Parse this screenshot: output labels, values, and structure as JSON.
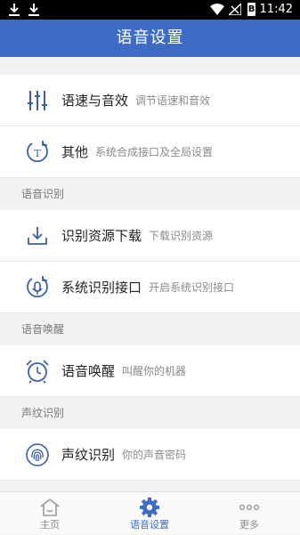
{
  "status_bar": {
    "time": "11:42",
    "battery_label": "B"
  },
  "header": {
    "title": "语音设置"
  },
  "sections": {
    "recognition": "语音识别",
    "wakeup": "语音唤醒",
    "voiceprint": "声纹识别"
  },
  "cells": {
    "speed_effect": {
      "title": "语速与音效",
      "subtitle": "调节语速和音效",
      "icon": "sliders-icon"
    },
    "other": {
      "title": "其他",
      "subtitle": "系统合成接口及全局设置",
      "icon": "text-refresh-icon"
    },
    "download": {
      "title": "识别资源下载",
      "subtitle": "下载识别资源",
      "icon": "download-icon"
    },
    "system_interface": {
      "title": "系统识别接口",
      "subtitle": "开启系统识别接口",
      "icon": "mic-refresh-icon"
    },
    "wakeup": {
      "title": "语音唤醒",
      "subtitle": "叫醒你的机器",
      "icon": "alarm-clock-icon"
    },
    "voiceprint": {
      "title": "声纹识别",
      "subtitle": "你的声音密码",
      "icon": "fingerprint-icon"
    }
  },
  "tabs": [
    {
      "label": "主页",
      "icon": "home-icon",
      "active": false
    },
    {
      "label": "语音设置",
      "icon": "gear-icon",
      "active": true
    },
    {
      "label": "更多",
      "icon": "more-icon",
      "active": false
    }
  ],
  "colors": {
    "accent": "#3e6cc4",
    "icon": "#3b5fa8",
    "inactive_tab": "#8a8a8a"
  }
}
